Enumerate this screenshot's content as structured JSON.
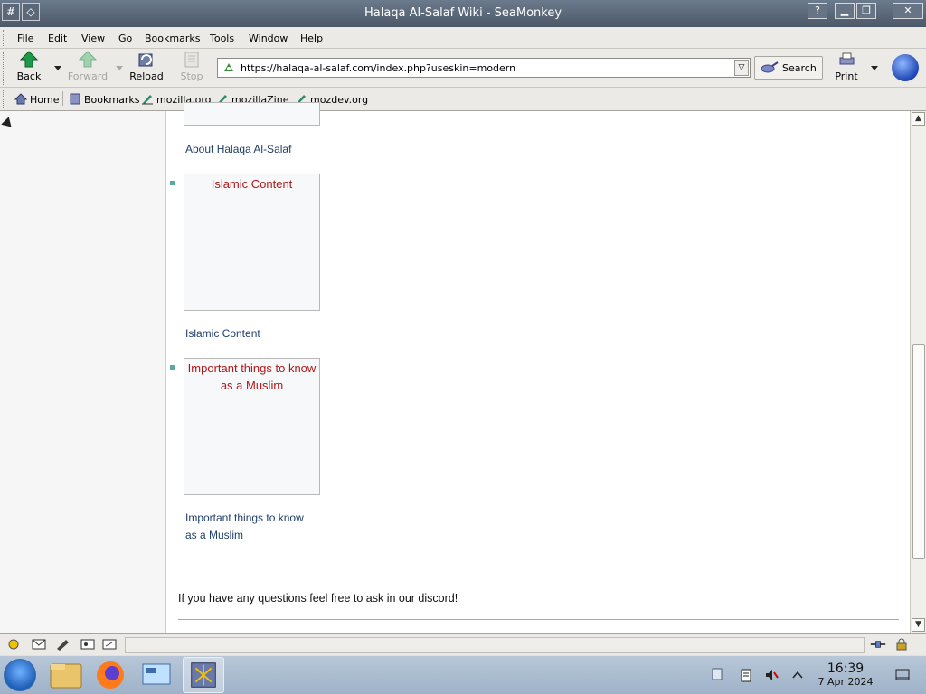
{
  "window": {
    "title": "Halaqa Al-Salaf Wiki - SeaMonkey",
    "help_btn": "?"
  },
  "menubar": {
    "items": [
      {
        "label": "File"
      },
      {
        "label": "Edit"
      },
      {
        "label": "View"
      },
      {
        "label": "Go"
      },
      {
        "label": "Bookmarks"
      },
      {
        "label": "Tools"
      },
      {
        "label": "Window"
      },
      {
        "label": "Help"
      }
    ]
  },
  "navbar": {
    "back": "Back",
    "forward": "Forward",
    "reload": "Reload",
    "stop": "Stop",
    "url": "https://halaqa-al-salaf.com/index.php?useskin=modern",
    "search": "Search",
    "print": "Print"
  },
  "personal_toolbar": {
    "items": [
      {
        "label": "Home",
        "icon": "home-icon"
      },
      {
        "label": "Bookmarks",
        "icon": "bookmarks-icon"
      },
      {
        "label": "mozilla.org",
        "icon": "link-icon"
      },
      {
        "label": "mozillaZine",
        "icon": "link-icon"
      },
      {
        "label": "mozdev.org",
        "icon": "link-icon"
      }
    ]
  },
  "page": {
    "sections": [
      {
        "box_title": "",
        "caption_lines": [
          "About Halaqa Al-Salaf"
        ]
      },
      {
        "box_title_lines": [
          "Islamic Content"
        ],
        "caption_lines": [
          "Islamic Content"
        ]
      },
      {
        "box_title_lines": [
          "Important things to know",
          "as a Muslim"
        ],
        "caption_lines": [
          "Important things to know",
          "as a Muslim"
        ]
      }
    ],
    "footer_text": "If you have any questions feel free to ask in our discord!"
  },
  "taskbar": {
    "time": "16:39",
    "date": "7 Apr 2024"
  },
  "colors": {
    "box_title": "#b01818",
    "caption": "#1f3f6a",
    "bullet": "#5aa9a0"
  }
}
